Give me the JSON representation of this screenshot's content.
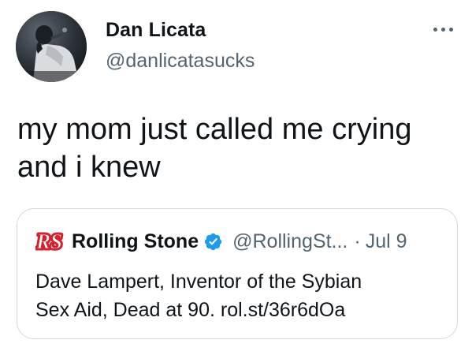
{
  "tweet": {
    "author": {
      "display_name": "Dan Licata",
      "handle": "@danlicatasucks",
      "avatar": "profile-photo"
    },
    "more_icon": "more-horizontal-icon",
    "text": "my mom just called me crying\nand i knew",
    "quoted_tweet": {
      "logo": "rolling-stone-logo",
      "display_name": "Rolling Stone",
      "verified_icon": "verified-badge-icon",
      "handle": "@RollingSt...",
      "separator": "·",
      "date": "Jul 9",
      "text": "Dave Lampert, Inventor of the Sybian\nSex Aid, Dead at 90. rol.st/36r6dOa"
    }
  },
  "colors": {
    "primary_text": "#0f1419",
    "secondary_text": "#536471",
    "card_border": "#cfd9de",
    "verified_blue": "#1d9bf0",
    "logo_red": "#d6202e"
  }
}
